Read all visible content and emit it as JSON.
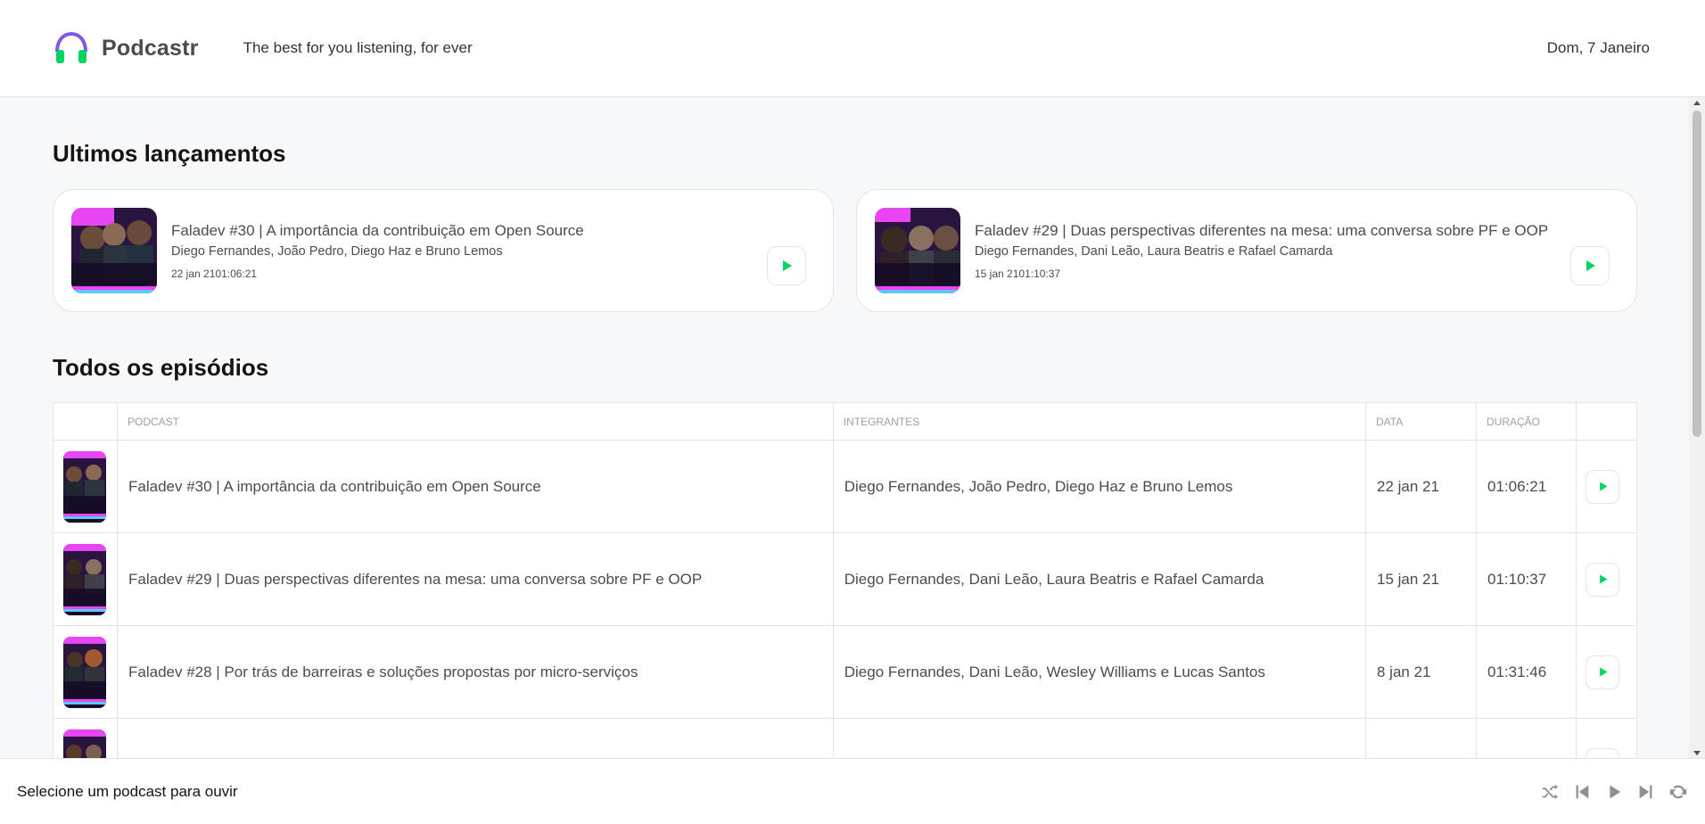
{
  "header": {
    "app_name": "Podcastr",
    "tagline": "The best for you listening, for ever",
    "date": "Dom, 7 Janeiro"
  },
  "latest": {
    "title": "Ultimos lançamentos",
    "items": [
      {
        "title": "Faladev #30 | A importância da contribuição em Open Source",
        "members": "Diego Fernandes, João Pedro, Diego Haz e Bruno Lemos",
        "published": "22 jan 21",
        "duration": "01:06:21"
      },
      {
        "title": "Faladev #29 | Duas perspectivas diferentes na mesa: uma conversa sobre PF e OOP",
        "members": "Diego Fernandes, Dani Leão, Laura Beatris e Rafael Camarda",
        "published": "15 jan 21",
        "duration": "01:10:37"
      }
    ]
  },
  "all": {
    "title": "Todos os episódios",
    "columns": [
      "",
      "Podcast",
      "Integrantes",
      "Data",
      "Duração",
      ""
    ],
    "rows": [
      {
        "title": "Faladev #30 | A importância da contribuição em Open Source",
        "members": "Diego Fernandes, João Pedro, Diego Haz e Bruno Lemos",
        "date": "22 jan 21",
        "duration": "01:06:21"
      },
      {
        "title": "Faladev #29 | Duas perspectivas diferentes na mesa: uma conversa sobre PF e OOP",
        "members": "Diego Fernandes, Dani Leão, Laura Beatris e Rafael Camarda",
        "date": "15 jan 21",
        "duration": "01:10:37"
      },
      {
        "title": "Faladev #28 | Por trás de barreiras e soluções propostas por micro-serviços",
        "members": "Diego Fernandes, Dani Leão, Wesley Williams e Lucas Santos",
        "date": "8 jan 21",
        "duration": "01:31:46"
      }
    ]
  },
  "player": {
    "empty_text": "Selecione um podcast para ouvir",
    "controls": [
      "shuffle-icon",
      "previous-icon",
      "play-icon",
      "next-icon",
      "repeat-icon"
    ]
  },
  "colors": {
    "accent_green": "#04d361",
    "brand_purple": "#8257e5",
    "thumb_pink": "#e845f5"
  }
}
